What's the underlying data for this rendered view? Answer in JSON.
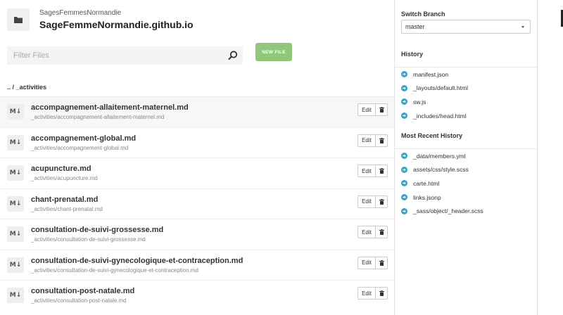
{
  "repo": {
    "owner": "SagesFemmesNormandie",
    "name": "SageFemmeNormandie.github.io"
  },
  "filter": {
    "placeholder": "Filter Files"
  },
  "new_file_label": "NEW FILE",
  "breadcrumb": {
    "parent": "..",
    "separator": "/",
    "current": "_activities"
  },
  "file_icon_label": "M↓",
  "edit_label": "Edit",
  "files": [
    {
      "name": "accompagnement-allaitement-maternel.md",
      "path": "_activities/accompagnement-allaitement-maternel.md"
    },
    {
      "name": "accompagnement-global.md",
      "path": "_activities/accompagnement-global.md"
    },
    {
      "name": "acupuncture.md",
      "path": "_activities/acupuncture.md"
    },
    {
      "name": "chant-prenatal.md",
      "path": "_activities/chant-prenatal.md"
    },
    {
      "name": "consultation-de-suivi-grossesse.md",
      "path": "_activities/consultation-de-suivi-grossesse.md"
    },
    {
      "name": "consultation-de-suivi-gynecologique-et-contraception.md",
      "path": "_activities/consultation-de-suivi-gynecologique-et-contraception.md"
    },
    {
      "name": "consultation-post-natale.md",
      "path": "_activities/consultation-post-natale.md"
    }
  ],
  "sidebar": {
    "switch_branch_title": "Switch Branch",
    "branch": "master",
    "history_title": "History",
    "history": [
      "manifest.json",
      "_layouts/default.html",
      "sw.js",
      "_includes/head.html"
    ],
    "recent_title": "Most Recent History",
    "recent": [
      "_data/members.yml",
      "assets/css/style.scss",
      "carte.html",
      "links.jsonp",
      "_sass/object/_header.scss"
    ]
  },
  "colors": {
    "accent_green": "#8fc77b",
    "history_icon": "#3aa3c6"
  },
  "icons": {
    "repo": "folder-icon",
    "search": "search-icon",
    "delete": "trash-icon",
    "history_item": "arrow-circle-icon"
  }
}
